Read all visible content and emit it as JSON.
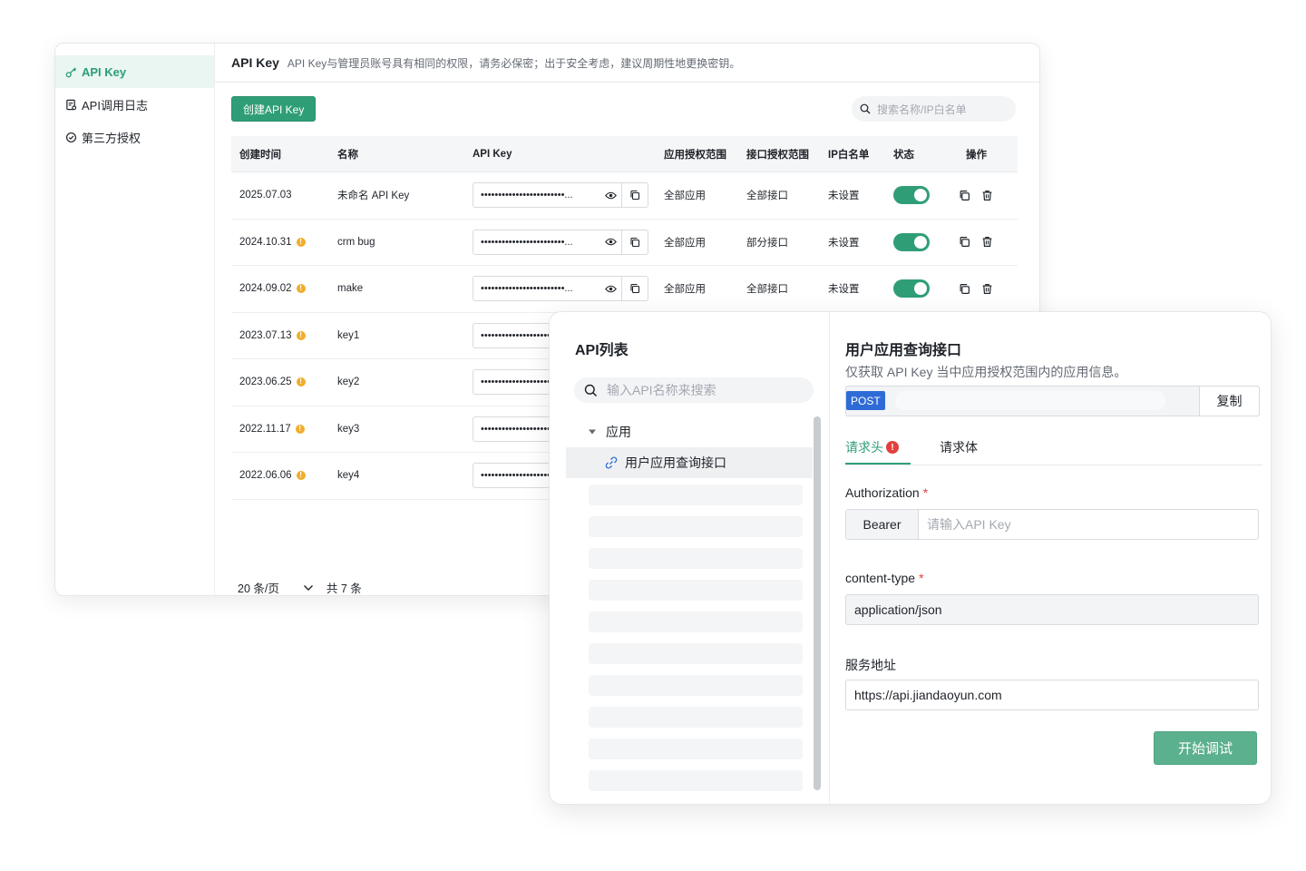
{
  "sidebar": {
    "items": [
      {
        "label": "API Key",
        "icon": "key-icon",
        "active": true
      },
      {
        "label": "API调用日志",
        "icon": "log-icon",
        "active": false
      },
      {
        "label": "第三方授权",
        "icon": "auth-icon",
        "active": false
      }
    ]
  },
  "apikey_page": {
    "title": "API Key",
    "description": "API Key与管理员账号具有相同的权限，请务必保密；出于安全考虑，建议周期性地更换密钥。",
    "create_button": "创建API Key",
    "search_placeholder": "搜索名称/IP白名单",
    "columns": [
      "创建时间",
      "名称",
      "API Key",
      "应用授权范围",
      "接口授权范围",
      "IP白名单",
      "状态",
      "操作"
    ],
    "rows": [
      {
        "created": "2025.07.03",
        "warning": false,
        "name": "未命名 API Key",
        "key_mask": "••••••••••••••••••••••••...",
        "app_scope": "全部应用",
        "api_scope": "全部接口",
        "ip_whitelist": "未设置",
        "enabled": true
      },
      {
        "created": "2024.10.31",
        "warning": true,
        "name": "crm bug",
        "key_mask": "••••••••••••••••••••••••...",
        "app_scope": "全部应用",
        "api_scope": "部分接口",
        "ip_whitelist": "未设置",
        "enabled": true
      },
      {
        "created": "2024.09.02",
        "warning": true,
        "name": "make",
        "key_mask": "••••••••••••••••••••••••...",
        "app_scope": "全部应用",
        "api_scope": "全部接口",
        "ip_whitelist": "未设置",
        "enabled": true
      },
      {
        "created": "2023.07.13",
        "warning": true,
        "name": "key1",
        "key_mask": "••••••••••••••••••••••••...",
        "app_scope": "",
        "api_scope": "",
        "ip_whitelist": "",
        "enabled": null
      },
      {
        "created": "2023.06.25",
        "warning": true,
        "name": "key2",
        "key_mask": "••••••••••••••••••••••••...",
        "app_scope": "",
        "api_scope": "",
        "ip_whitelist": "",
        "enabled": null
      },
      {
        "created": "2022.11.17",
        "warning": true,
        "name": "key3",
        "key_mask": "••••••••••••••••••••••••...",
        "app_scope": "",
        "api_scope": "",
        "ip_whitelist": "",
        "enabled": null
      },
      {
        "created": "2022.06.06",
        "warning": true,
        "name": "key4",
        "key_mask": "••••••••••••••••••••••••...",
        "app_scope": "",
        "api_scope": "",
        "ip_whitelist": "",
        "enabled": null
      }
    ],
    "pager": {
      "page_size": "20 条/页",
      "total": "共 7 条"
    }
  },
  "api_debug": {
    "list_title": "API列表",
    "list_search_placeholder": "输入API名称来搜索",
    "tree_group": "应用",
    "tree_leaf": "用户应用查询接口",
    "detail_title": "用户应用查询接口",
    "detail_desc": "仅获取 API Key 当中应用授权范围内的应用信息。",
    "method": "POST",
    "copy_label": "复制",
    "tabs": [
      {
        "label": "请求头",
        "error": "!"
      },
      {
        "label": "请求体"
      }
    ],
    "authorization_label": "Authorization",
    "required_mark": "*",
    "bearer_label": "Bearer",
    "authorization_placeholder": "请输入API Key",
    "content_type_label": "content-type",
    "content_type_value": "application/json",
    "service_label": "服务地址",
    "service_value": "https://api.jiandaoyun.com",
    "debug_button": "开始调试"
  },
  "colors": {
    "accent": "#2f9e76",
    "method_blue": "#2f6bd6",
    "warning": "#f0ad2b",
    "error": "#e0413d"
  }
}
